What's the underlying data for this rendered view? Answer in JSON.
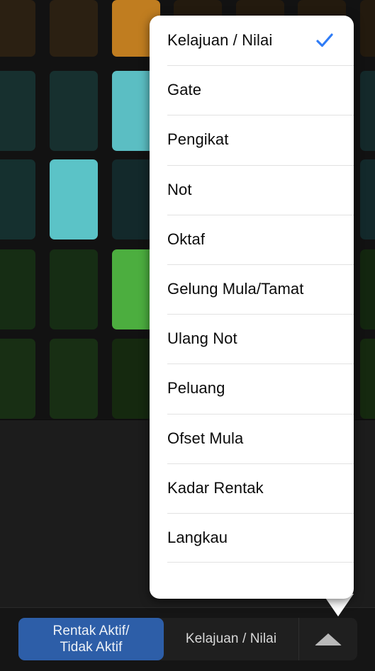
{
  "grid": {
    "background": "#121212",
    "rows": [
      {
        "name": "row-1",
        "base_color": "#2b2012",
        "cells": [
          {
            "color": "#2b2012"
          },
          {
            "color": "#2b2012"
          },
          {
            "color": "#c07d20"
          },
          {
            "color": "#231a0e"
          },
          {
            "color": "#231a0e"
          },
          {
            "color": "#231a0e"
          },
          {
            "color": "#231a0e"
          }
        ]
      },
      {
        "name": "row-2",
        "base_color": "#17302f",
        "cells": [
          {
            "color": "#17302f"
          },
          {
            "color": "#17302f"
          },
          {
            "color": "#5bbec3"
          },
          {
            "color": "#14292a"
          },
          {
            "color": "#14292a"
          },
          {
            "color": "#14292a"
          },
          {
            "color": "#14292a"
          }
        ]
      },
      {
        "name": "row-3",
        "base_color": "#15302f",
        "cells": [
          {
            "color": "#15302f"
          },
          {
            "color": "#5bc3c7"
          },
          {
            "color": "#13292b"
          },
          {
            "color": "#13292b"
          },
          {
            "color": "#13292b"
          },
          {
            "color": "#13292b"
          },
          {
            "color": "#13292b"
          }
        ]
      },
      {
        "name": "row-4",
        "base_color": "#162d14",
        "cells": [
          {
            "color": "#162d14"
          },
          {
            "color": "#162d14"
          },
          {
            "color": "#4cae3f"
          },
          {
            "color": "#13260f"
          },
          {
            "color": "#13260f"
          },
          {
            "color": "#13260f"
          },
          {
            "color": "#13260f"
          }
        ]
      },
      {
        "name": "row-5",
        "base_color": "#182f14",
        "cells": [
          {
            "color": "#182f14"
          },
          {
            "color": "#182f14"
          },
          {
            "color": "#15290f"
          },
          {
            "color": "#15290f"
          },
          {
            "color": "#15290f"
          },
          {
            "color": "#15290f"
          },
          {
            "color": "#15290f"
          }
        ]
      }
    ]
  },
  "menu": {
    "name": "parameter-popover-menu",
    "selected": "Kelajuan / Nilai",
    "check_color": "#2f7cf6",
    "background": "#ffffff",
    "items": [
      {
        "label": "Kelajuan / Nilai",
        "checked": true
      },
      {
        "label": "Gate",
        "checked": false
      },
      {
        "label": "Pengikat",
        "checked": false
      },
      {
        "label": "Not",
        "checked": false
      },
      {
        "label": "Oktaf",
        "checked": false
      },
      {
        "label": "Gelung Mula/Tamat",
        "checked": false
      },
      {
        "label": "Ulang Not",
        "checked": false
      },
      {
        "label": "Peluang",
        "checked": false
      },
      {
        "label": "Ofset Mula",
        "checked": false
      },
      {
        "label": "Kadar Rentak",
        "checked": false
      },
      {
        "label": "Langkau",
        "checked": false
      }
    ]
  },
  "bottom_bar": {
    "toggle_line1": "Rentak Aktif/",
    "toggle_line2": "Tidak Aktif",
    "toggle_color": "#2d5ea8",
    "parameter_label": "Kelajuan / Nilai",
    "disclosure_icon": "triangle-up-icon"
  }
}
